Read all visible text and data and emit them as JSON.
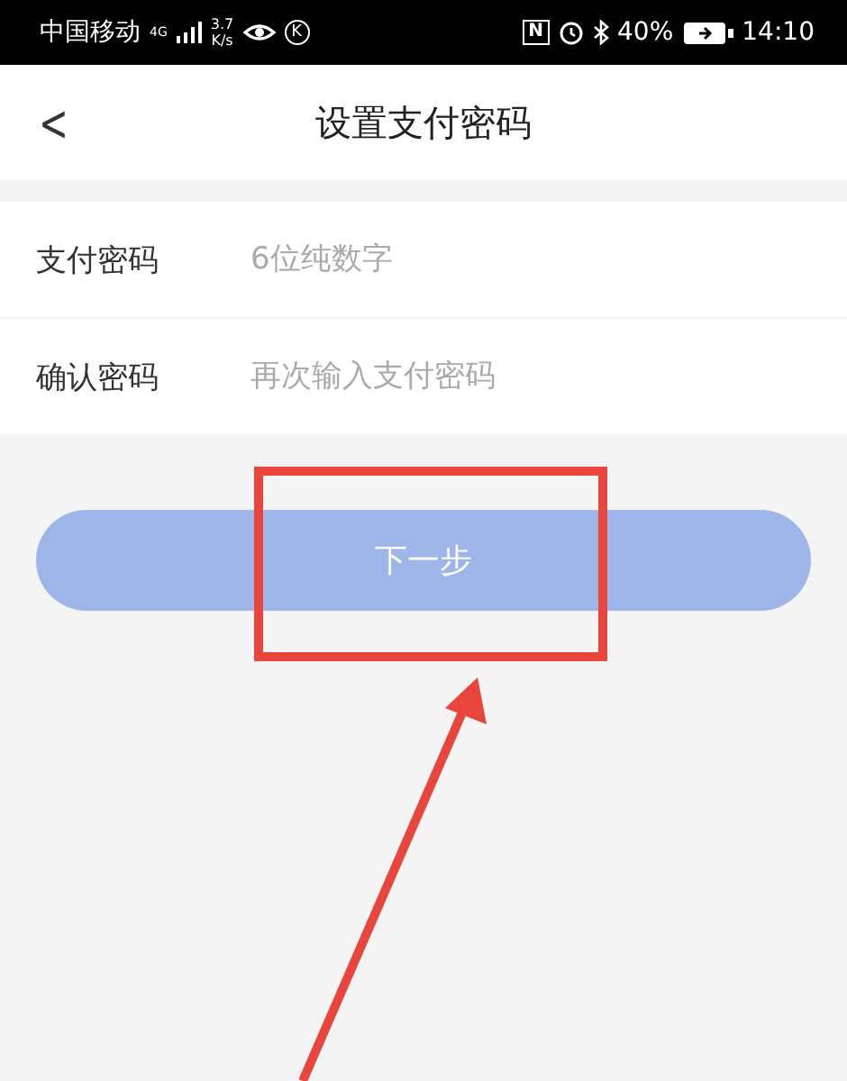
{
  "status_bar": {
    "carrier": "中国移动",
    "network": "4G",
    "speed": "3.7",
    "speed_unit": "K/s",
    "k_badge": "K",
    "nfc": "N",
    "battery": "40%",
    "time": "14:10"
  },
  "header": {
    "back": "<",
    "title": "设置支付密码"
  },
  "fields": [
    {
      "label": "支付密码",
      "placeholder": "6位纯数字"
    },
    {
      "label": "确认密码",
      "placeholder": "再次输入支付密码"
    }
  ],
  "next_button": {
    "label": "下一步",
    "disabled": true
  },
  "annotation": {
    "highlight_box": true,
    "arrow": true
  }
}
